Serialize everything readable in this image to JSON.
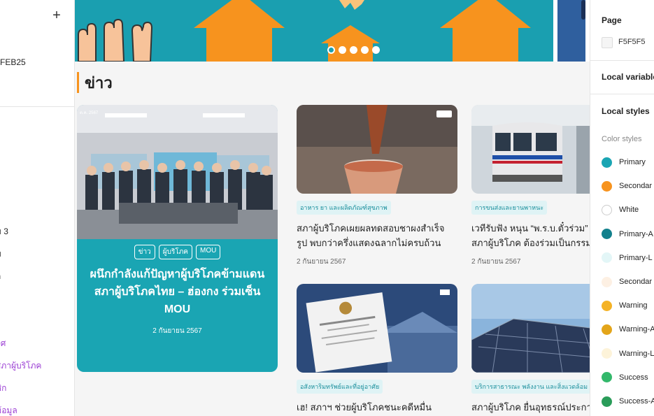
{
  "left_panel": {
    "version_label": "FEB25",
    "items": [
      {
        "label": "ม 3",
        "purple": false
      },
      {
        "label": "ม",
        "purple": false
      },
      {
        "label": "ก",
        "purple": false
      },
      {
        "label": "าศ",
        "purple": true
      },
      {
        "label": "สภาผู้บริโภค",
        "purple": true
      },
      {
        "label": "ชิก",
        "purple": true
      },
      {
        "label": "ข้อมูล",
        "purple": true
      }
    ]
  },
  "hero": {
    "colors": {
      "background": "#1a9fb0",
      "accent": "#f7931e"
    }
  },
  "section": {
    "title": "ข่าว"
  },
  "featured": {
    "photo_text": "ต.ค. 2567",
    "tags": [
      "ข่าว",
      "ผู้บริโภค",
      "MOU"
    ],
    "title": "ผนึกกำลังแก้ปัญหาผู้บริโภคข้ามแดน สภาผู้บริโภคไทย – ฮ่องกง ร่วมเซ็น MOU",
    "date": "2 กันยายน 2567"
  },
  "cards": [
    {
      "tag": "อาหาร ยา และผลิตภัณฑ์สุขภาพ",
      "title_line1": "สภาผู้บริโภคเผยผลทดสอบชาผงสำเร็จ",
      "title_line2": "รูป พบกว่าครึ่งแสดงฉลากไม่ครบถ้วน",
      "date": "2 กันยายน 2567"
    },
    {
      "tag": "การขนส่งและยานพาหนะ",
      "title_line1": "เวทีรับฟัง หนุน “พ.ร.บ.ตั๋วร่วม”",
      "title_line2": "สภาผู้บริโภค ต้องร่วมเป็นกรรม",
      "date": "2 กันยายน 2567"
    },
    {
      "tag": "อสังหาริมทรัพย์และที่อยู่อาศัย",
      "title_line1": "เฮ! สภาฯ ช่วยผู้บริโภคชนะคดีหมื่น",
      "title_line2": "",
      "date": ""
    },
    {
      "tag": "บริการสาธารณะ พลังงาน และสิ่งแวดล้อม",
      "title_line1": "สภาผู้บริโภค ยื่นอุทธรณ์ประกา",
      "title_line2": "",
      "date": ""
    }
  ],
  "right_panel": {
    "page_heading": "Page",
    "page_color": "F5F5F5",
    "local_variables": "Local variables",
    "local_styles": "Local styles",
    "color_styles_label": "Color styles",
    "styles": [
      {
        "name": "Primary",
        "color": "#1aa5b3"
      },
      {
        "name": "Secondar",
        "color": "#f7931e"
      },
      {
        "name": "White",
        "color": "#ffffff"
      },
      {
        "name": "Primary-A",
        "color": "#12808c"
      },
      {
        "name": "Primary-L",
        "color": "#e3f6f7"
      },
      {
        "name": "Secondar",
        "color": "#fdf0e3"
      },
      {
        "name": "Warning",
        "color": "#f4b225"
      },
      {
        "name": "Warning-A",
        "color": "#e3a51a"
      },
      {
        "name": "Warning-L",
        "color": "#fdf3d9"
      },
      {
        "name": "Success",
        "color": "#33b86b"
      },
      {
        "name": "Success-A",
        "color": "#2a9c59"
      }
    ]
  }
}
